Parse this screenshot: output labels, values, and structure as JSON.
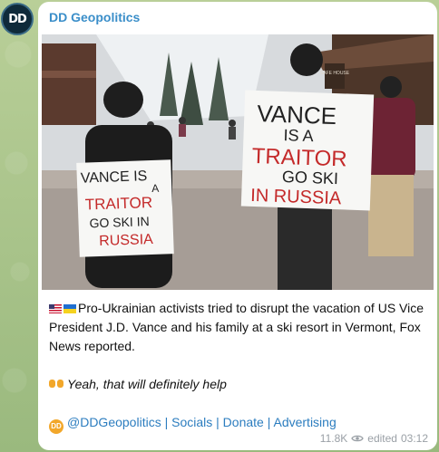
{
  "channel": {
    "avatar_text": "DD",
    "name": "DD Geopolitics"
  },
  "photo": {
    "sign_left": [
      "VANCE IS",
      "A",
      "TRAITOR",
      "GO SKI IN",
      "RUSSIA"
    ],
    "sign_right": [
      "VANCE",
      "IS A",
      "TRAITOR",
      "GO SKI",
      "IN RUSSIA"
    ],
    "building_sign": "SAFE HOUSE"
  },
  "post": {
    "main_text": "Pro-Ukrainian activists tried to disrupt the vacation of US Vice President J.D. Vance and his family at a ski resort in Vermont, Fox News reported.",
    "italic_text": "Yeah, that will definitely help",
    "links": [
      "@DDGeopolitics",
      "Socials",
      "Donate",
      "Advertising"
    ],
    "link_separator": " | "
  },
  "meta": {
    "views": "11.8K",
    "edited_label": "edited",
    "time": "03:12"
  },
  "colors": {
    "accent": "#3a8ec9",
    "link": "#2c7dbf",
    "chat_bg": "#a9c38f"
  }
}
